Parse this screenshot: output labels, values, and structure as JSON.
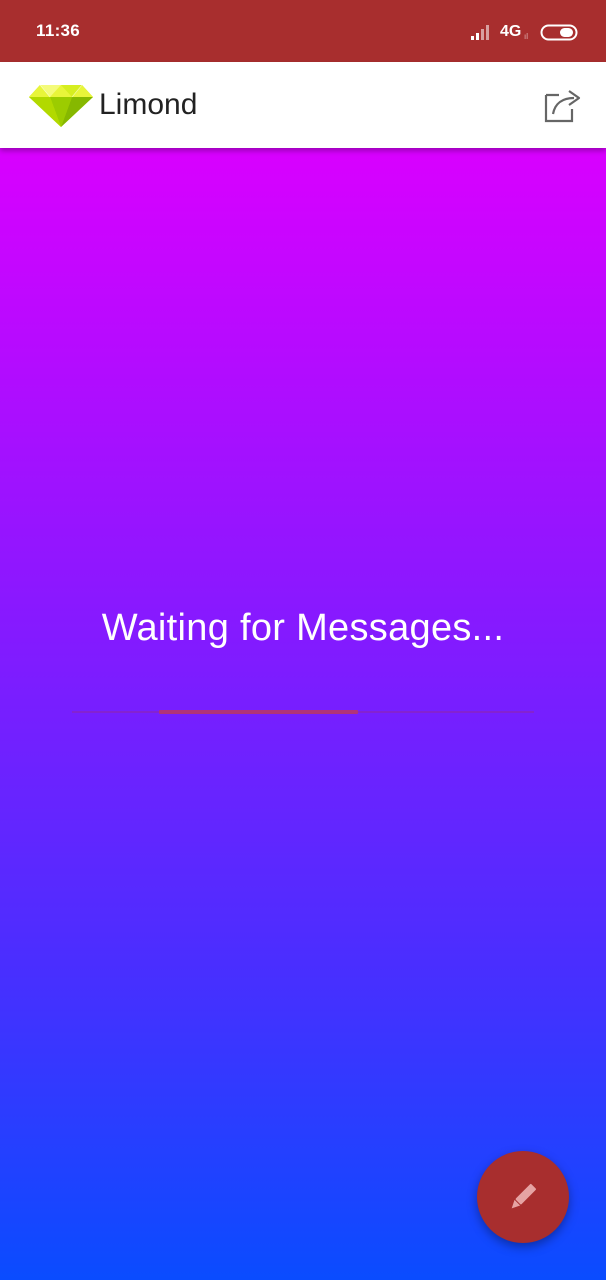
{
  "status_bar": {
    "time": "11:36",
    "network": "4G",
    "network_sub": "ıl",
    "icons": [
      "signal-icon",
      "battery-icon"
    ]
  },
  "app_bar": {
    "title": "Limond",
    "logo_icon": "diamond-logo-icon",
    "share_icon": "share-icon"
  },
  "main": {
    "waiting_text": "Waiting for Messages...",
    "progress": 0.43
  },
  "fab": {
    "icon": "pencil-icon"
  },
  "colors": {
    "status_bar": "#a82e2e",
    "app_bar": "#ffffff",
    "gradient_top": "#d900ff",
    "gradient_bottom": "#0a4cff",
    "fab": "#a82e2e",
    "progress": "#b0337a"
  }
}
